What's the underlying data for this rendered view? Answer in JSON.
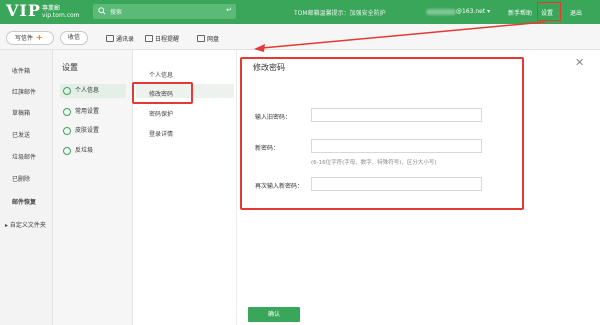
{
  "header": {
    "logo_vip": "VIP",
    "logo_cn": "專業郵",
    "logo_url": "vip.tom.com",
    "search_placeholder": "搜索",
    "search_enter": "↵",
    "notice": "TOM邮箱温馨提示：加强安全防护",
    "account_suffix": "@163.net ▾",
    "links": [
      "新手帮助",
      "设置",
      "退出"
    ],
    "accent_color": "#3aa65a"
  },
  "toolbar": {
    "write": "写信件",
    "write_plus": "+",
    "inbox": "收信",
    "tools": [
      "通讯录",
      "日程提醒",
      "网盘"
    ]
  },
  "leftnav": {
    "items": [
      "收件箱",
      "红旗邮件",
      "草稿箱",
      "已发送",
      "垃圾邮件",
      "已删除",
      "邮件恢复",
      "▸ 自定义文件夹"
    ]
  },
  "settings": {
    "title": "设置",
    "menu": [
      {
        "label": "个人信息",
        "icon": "person-icon"
      },
      {
        "label": "常用设置",
        "icon": "gear-icon"
      },
      {
        "label": "皮肤设置",
        "icon": "shirt-icon"
      },
      {
        "label": "反垃圾",
        "icon": "shield-icon"
      }
    ],
    "submenu": [
      "个人信息",
      "修改密码",
      "密码保护",
      "登录详情"
    ]
  },
  "form": {
    "title": "修改密码",
    "close": "✕",
    "old_password_label": "输入旧密码：",
    "new_password_label": "新密码：",
    "hint": "(6-16位字符(字母、数字、特殊符号)，区分大小写)",
    "confirm_password_label": "再次输入新密码：",
    "confirm_button": "确认"
  }
}
